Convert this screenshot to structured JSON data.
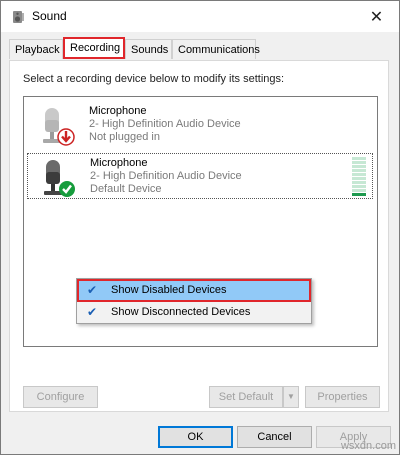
{
  "window": {
    "title": "Sound",
    "close_glyph": "✕"
  },
  "tabs": [
    {
      "label": "Playback"
    },
    {
      "label": "Recording"
    },
    {
      "label": "Sounds"
    },
    {
      "label": "Communications"
    }
  ],
  "instruction": "Select a recording device below to modify its settings:",
  "devices": [
    {
      "name": "Microphone",
      "driver": "2- High Definition Audio Device",
      "status": "Not plugged in",
      "status_icon": "red-down-arrow-icon"
    },
    {
      "name": "Microphone",
      "driver": "2- High Definition Audio Device",
      "status": "Default Device",
      "status_icon": "green-check-icon",
      "level_fraction": 0.1
    }
  ],
  "context_menu": {
    "items": [
      {
        "label": "Show Disabled Devices",
        "checked": true
      },
      {
        "label": "Show Disconnected Devices",
        "checked": true
      }
    ],
    "check_glyph": "✔"
  },
  "buttons": {
    "configure": "Configure",
    "set_default": "Set Default",
    "properties": "Properties",
    "ok": "OK",
    "cancel": "Cancel",
    "apply": "Apply"
  },
  "watermark": "wsxdn.com",
  "colors": {
    "highlight_red": "#e0262b",
    "menu_hover": "#91c9f7",
    "accent_blue": "#0078d7",
    "level_green": "#1e9a4f"
  }
}
